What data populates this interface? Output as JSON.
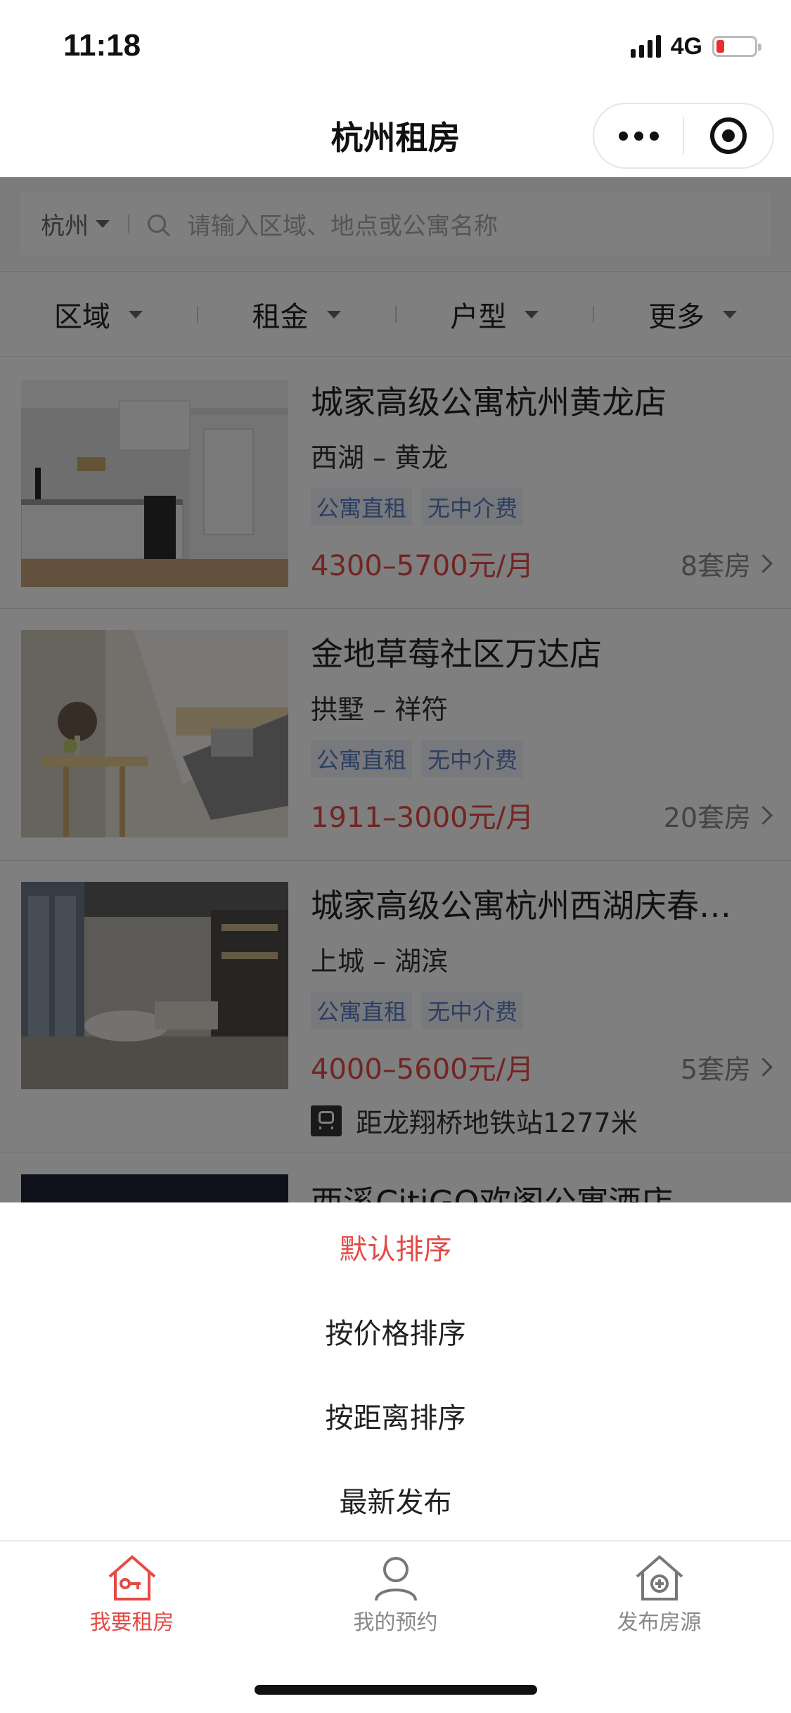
{
  "status_bar": {
    "time": "11:18",
    "network": "4G"
  },
  "nav": {
    "title": "杭州租房"
  },
  "search": {
    "city": "杭州",
    "placeholder": "请输入区域、地点或公寓名称"
  },
  "filters": [
    {
      "label": "区域"
    },
    {
      "label": "租金"
    },
    {
      "label": "户型"
    },
    {
      "label": "更多"
    }
  ],
  "listings": [
    {
      "title": "城家高级公寓杭州黄龙店",
      "location": "西湖 – 黄龙",
      "tags": [
        "公寓直租",
        "无中介费"
      ],
      "price": "4300–5700元/月",
      "count": "8套房"
    },
    {
      "title": "金地草莓社区万达店",
      "location": "拱墅 – 祥符",
      "tags": [
        "公寓直租",
        "无中介费"
      ],
      "price": "1911–3000元/月",
      "count": "20套房"
    },
    {
      "title": "城家高级公寓杭州西湖庆春…",
      "location": "上城 – 湖滨",
      "tags": [
        "公寓直租",
        "无中介费"
      ],
      "price": "4000–5600元/月",
      "count": "5套房",
      "metro": "距龙翔桥地铁站1277米"
    },
    {
      "title": "西溪CitiGO欢阁公寓酒店"
    }
  ],
  "sort_menu": {
    "items": [
      "默认排序",
      "按价格排序",
      "按距离排序",
      "最新发布"
    ],
    "active_index": 0
  },
  "tabbar": {
    "items": [
      {
        "label": "我要租房",
        "icon": "house-key-icon",
        "active": true
      },
      {
        "label": "我的预约",
        "icon": "user-icon",
        "active": false
      },
      {
        "label": "发布房源",
        "icon": "house-plus-icon",
        "active": false
      }
    ]
  },
  "colors": {
    "accent": "#e54a45",
    "tag_text": "#5b7fc3",
    "tag_bg": "#eef3fb",
    "overlay": "rgba(0,0,0,0.5)"
  }
}
